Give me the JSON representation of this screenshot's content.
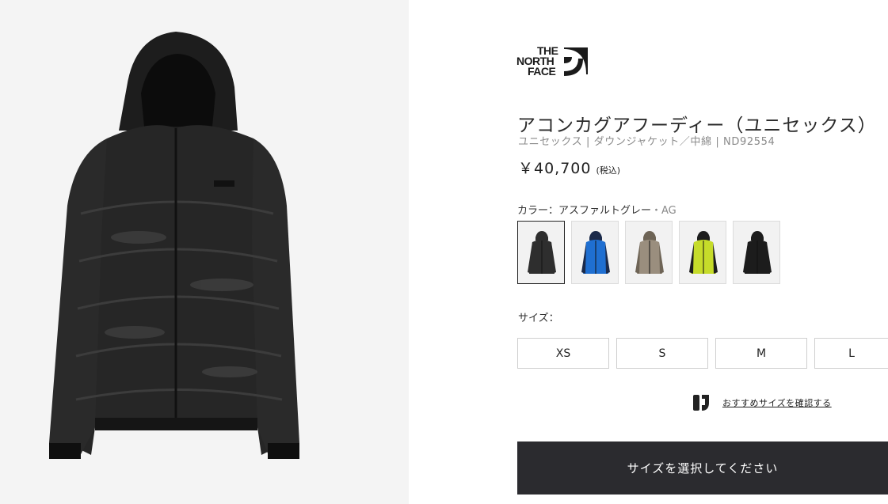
{
  "product": {
    "brand": "THE NORTH FACE",
    "title": "アコンカグアフーディー（ユニセックス）",
    "meta": "ユニセックス | ダウンジャケット／中綿 | ND92554",
    "price": "￥40,700",
    "tax": "(税込)"
  },
  "color": {
    "label": "カラー：アスファルトグレー",
    "code": "・AG",
    "swatches": [
      {
        "name": "asphalt-grey",
        "color": "#2e2e2e",
        "accent": "#2e2e2e"
      },
      {
        "name": "blue",
        "color": "#1f6fd1",
        "accent": "#1b2a4a"
      },
      {
        "name": "khaki",
        "color": "#9a8e7e",
        "accent": "#6e6456"
      },
      {
        "name": "lime",
        "color": "#c6dc2a",
        "accent": "#1e1e1e"
      },
      {
        "name": "black",
        "color": "#1c1c1c",
        "accent": "#1c1c1c"
      }
    ]
  },
  "size": {
    "label": "サイズ：",
    "options": [
      "XS",
      "S",
      "M",
      "L"
    ]
  },
  "recommend": {
    "label": "おすすめサイズを確認する",
    "icon": "size-advisor-icon"
  },
  "cta": {
    "label": "サイズを選択してください"
  }
}
